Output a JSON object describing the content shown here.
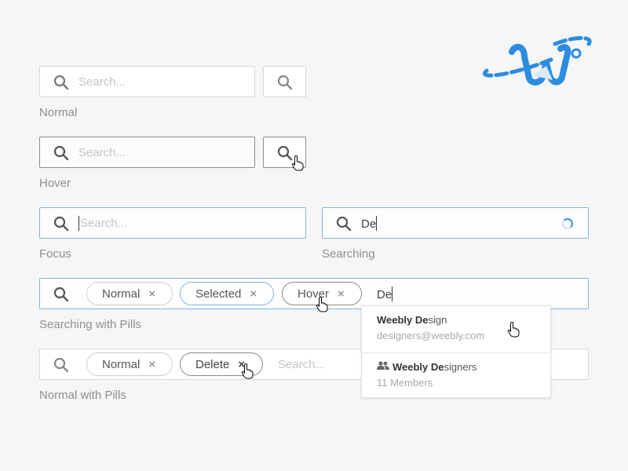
{
  "logo": {
    "name": "Weebly logo",
    "color": "#2b8ce0"
  },
  "placeholder": "Search...",
  "sections": {
    "normal": {
      "label": "Normal"
    },
    "hover": {
      "label": "Hover"
    },
    "focus": {
      "label": "Focus"
    },
    "searching": {
      "label": "Searching",
      "value": "De"
    },
    "searching_pills": {
      "label": "Searching with Pills",
      "value": "De",
      "pills": [
        {
          "label": "Normal",
          "state": "normal"
        },
        {
          "label": "Selected",
          "state": "selected"
        },
        {
          "label": "Hover",
          "state": "hover"
        }
      ]
    },
    "normal_pills": {
      "label": "Normal with Pills",
      "pills": [
        {
          "label": "Normal",
          "state": "normal"
        },
        {
          "label": "Delete",
          "state": "delete"
        }
      ]
    }
  },
  "dropdown": {
    "items": [
      {
        "title_match": "Weebly De",
        "title_rest": "sign",
        "subtitle": "designers@weebly.com",
        "icon": "none"
      },
      {
        "title_match": "Weebly De",
        "title_rest": "signers",
        "subtitle": "11 Members",
        "icon": "group-icon"
      }
    ]
  },
  "pill_remove_glyph": "×",
  "colors": {
    "focus_border": "#7fb5de",
    "accent": "#2b8ce0",
    "label": "#8e8e8e"
  }
}
